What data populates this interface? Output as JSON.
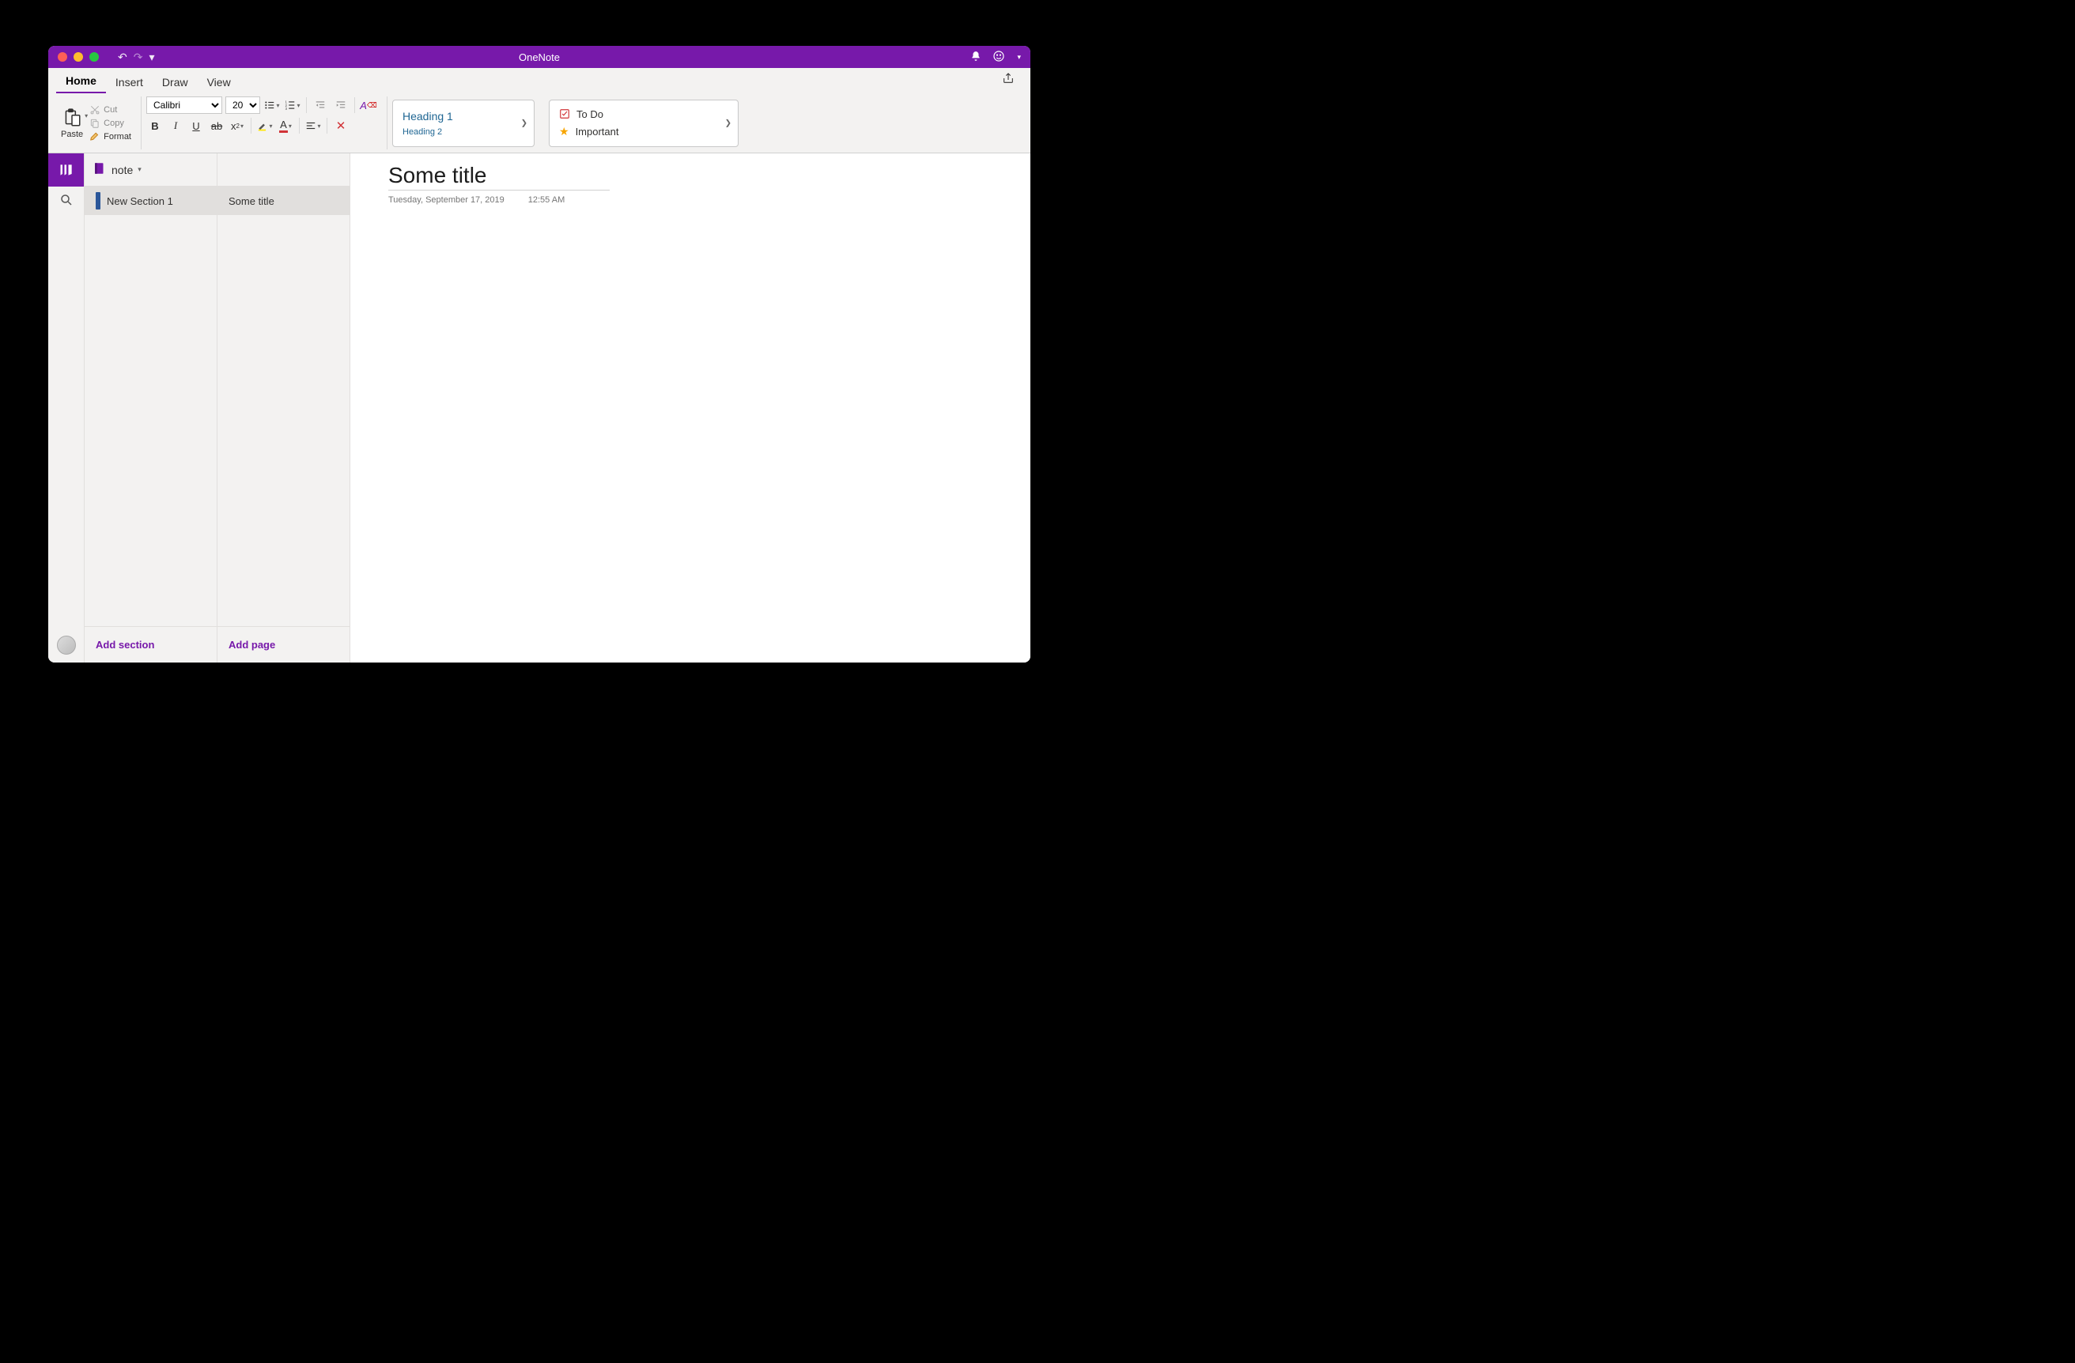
{
  "app": {
    "title": "OneNote"
  },
  "menubar": {
    "tabs": [
      {
        "label": "Home",
        "active": true
      },
      {
        "label": "Insert"
      },
      {
        "label": "Draw"
      },
      {
        "label": "View"
      }
    ]
  },
  "ribbon": {
    "paste_label": "Paste",
    "clip": {
      "cut": "Cut",
      "copy": "Copy",
      "format": "Format"
    },
    "font": {
      "name": "Calibri",
      "size": "20"
    },
    "styles": {
      "heading1": "Heading 1",
      "heading2": "Heading 2"
    },
    "tags": {
      "todo": "To Do",
      "important": "Important"
    }
  },
  "notebook": {
    "name": "note"
  },
  "sections": [
    {
      "name": "New Section 1"
    }
  ],
  "pages": [
    {
      "name": "Some title"
    }
  ],
  "add_section_label": "Add section",
  "add_page_label": "Add page",
  "page": {
    "title": "Some title",
    "date": "Tuesday, September 17, 2019",
    "time": "12:55 AM"
  }
}
